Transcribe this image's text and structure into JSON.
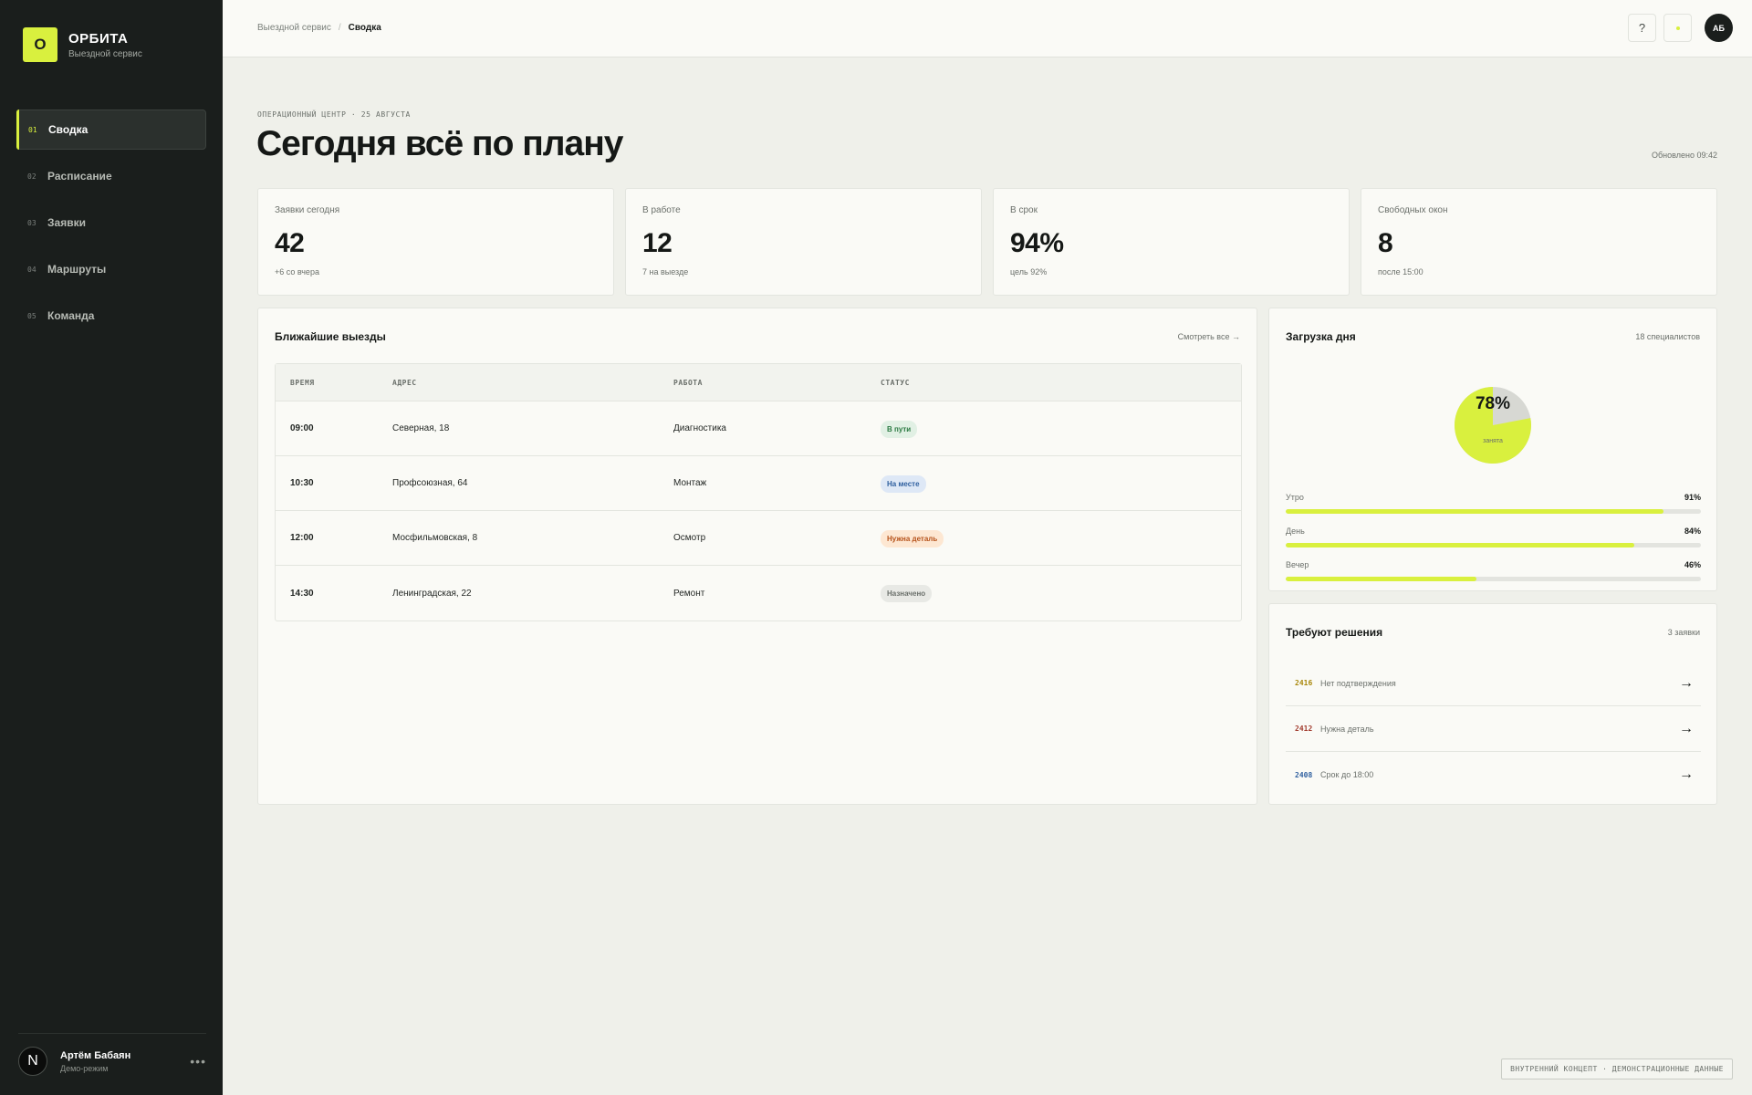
{
  "brand": {
    "logo_letter": "О",
    "name": "ОРБИТА",
    "subtitle": "Выездной сервис",
    "accent": "#d9f03e"
  },
  "nav": [
    {
      "num": "01",
      "label": "Сводка",
      "active": true
    },
    {
      "num": "02",
      "label": "Расписание",
      "active": false
    },
    {
      "num": "03",
      "label": "Заявки",
      "active": false
    },
    {
      "num": "04",
      "label": "Маршруты",
      "active": false
    },
    {
      "num": "05",
      "label": "Команда",
      "active": false
    }
  ],
  "user": {
    "avatar_letter": "N",
    "name": "Артём Бабаян",
    "role": "Демо-режим",
    "menu": "•••"
  },
  "topbar": {
    "breadcrumb_parent": "Выездной сервис",
    "breadcrumb_sep": "/",
    "breadcrumb_current": "Сводка",
    "help_label": "?",
    "avatar_initials": "АБ"
  },
  "header": {
    "eyebrow": "ОПЕРАЦИОННЫЙ ЦЕНТР · 25 АВГУСТА",
    "title": "Сегодня всё по плану",
    "updated": "Обновлено 09:42"
  },
  "kpis": [
    {
      "label": "Заявки сегодня",
      "value": "42",
      "sub": "+6 со вчера"
    },
    {
      "label": "В работе",
      "value": "12",
      "sub": "7 на выезде"
    },
    {
      "label": "В срок",
      "value": "94%",
      "sub": "цель 92%"
    },
    {
      "label": "Свободных окон",
      "value": "8",
      "sub": "после 15:00"
    }
  ],
  "visits": {
    "title": "Ближайшие выезды",
    "see_all": "Смотреть все →",
    "columns": [
      "ВРЕМЯ",
      "АДРЕС",
      "РАБОТА",
      "СТАТУС"
    ],
    "rows": [
      {
        "time": "09:00",
        "address": "Северная, 18",
        "work": "Диагностика",
        "status": "В пути",
        "status_kind": "green"
      },
      {
        "time": "10:30",
        "address": "Профсоюзная, 64",
        "work": "Монтаж",
        "status": "На месте",
        "status_kind": "blue"
      },
      {
        "time": "12:00",
        "address": "Мосфильмовская, 8",
        "work": "Осмотр",
        "status": "Нужна деталь",
        "status_kind": "orange"
      },
      {
        "time": "14:30",
        "address": "Ленинградская, 22",
        "work": "Ремонт",
        "status": "Назначено",
        "status_kind": "grey"
      }
    ]
  },
  "load": {
    "title": "Загрузка дня",
    "meta": "18 специалистов",
    "donut_percent": 78,
    "donut_value": "78%",
    "donut_caption": "занята",
    "colors": {
      "filled": "#d9f03e",
      "rest": "#d7d8d3"
    },
    "bars": [
      {
        "label": "Утро",
        "value_text": "91%",
        "value": 91
      },
      {
        "label": "День",
        "value_text": "84%",
        "value": 84
      },
      {
        "label": "Вечер",
        "value_text": "46%",
        "value": 46
      }
    ]
  },
  "decisions": {
    "title": "Требуют решения",
    "meta": "3 заявки",
    "items": [
      {
        "id": "2416",
        "text": "Нет подтверждения",
        "color": "#a8870a",
        "arrow": "→"
      },
      {
        "id": "2412",
        "text": "Нужна деталь",
        "color": "#a13a2c",
        "arrow": "→"
      },
      {
        "id": "2408",
        "text": "Срок до 18:00",
        "color": "#2d5e9e",
        "arrow": "→"
      }
    ]
  },
  "footer_note": "ВНУТРЕННИЙ КОНЦЕПТ · ДЕМОНСТРАЦИОННЫЕ ДАННЫЕ"
}
